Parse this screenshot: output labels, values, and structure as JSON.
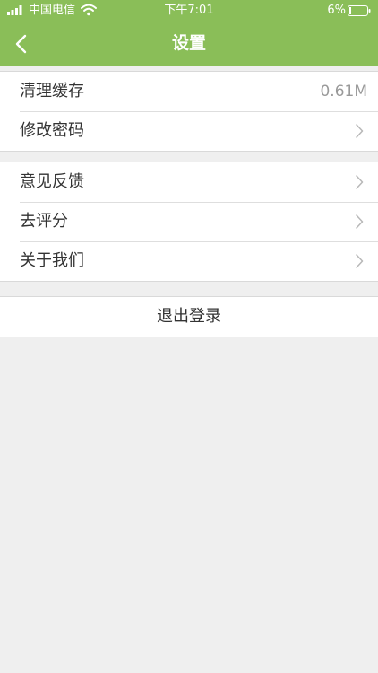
{
  "status_bar": {
    "carrier": "中国电信",
    "time": "下午7:01",
    "battery": "6%"
  },
  "nav": {
    "title": "设置",
    "back_icon": "chevron-left-icon"
  },
  "settings": {
    "group1": [
      {
        "label": "清理缓存",
        "value": "0.61M"
      },
      {
        "label": "修改密码"
      }
    ],
    "group2": [
      {
        "label": "意见反馈"
      },
      {
        "label": "去评分"
      },
      {
        "label": "关于我们"
      }
    ]
  },
  "logout": {
    "label": "退出登录"
  },
  "colors": {
    "header": "#8abe58",
    "background": "#efefef"
  }
}
